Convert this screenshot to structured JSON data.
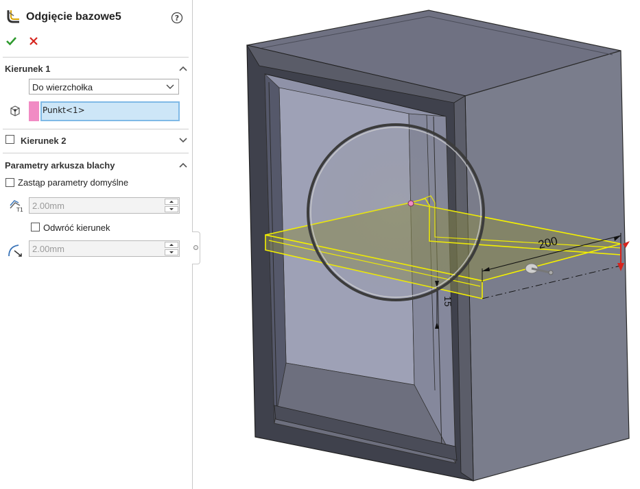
{
  "panel": {
    "title": "Odgięcie bazowe5",
    "direction1": {
      "title": "Kierunek 1",
      "end_condition": "Do wierzchołka",
      "vertex_selection": "Punkt<1>"
    },
    "direction2": {
      "title": "Kierunek 2",
      "checked": false
    },
    "sheet_metal": {
      "title": "Parametry arkusza blachy",
      "override_label": "Zastąp parametry domyślne",
      "thickness": "2.00mm",
      "reverse_label": "Odwróć kierunek",
      "bend_radius": "2.00mm"
    }
  },
  "viewport": {
    "dimension_length": "200",
    "dimension_depth": "15"
  },
  "colors": {
    "confirm": "#2e9a2e",
    "cancel": "#d6241d",
    "selection_pink": "#f18bc4",
    "preview_yellow": "#f4f000"
  },
  "icons": [
    "base-flange-icon",
    "help-icon",
    "ok-check-icon",
    "cancel-x-icon",
    "vertex-icon",
    "thickness-icon",
    "bend-radius-icon"
  ]
}
